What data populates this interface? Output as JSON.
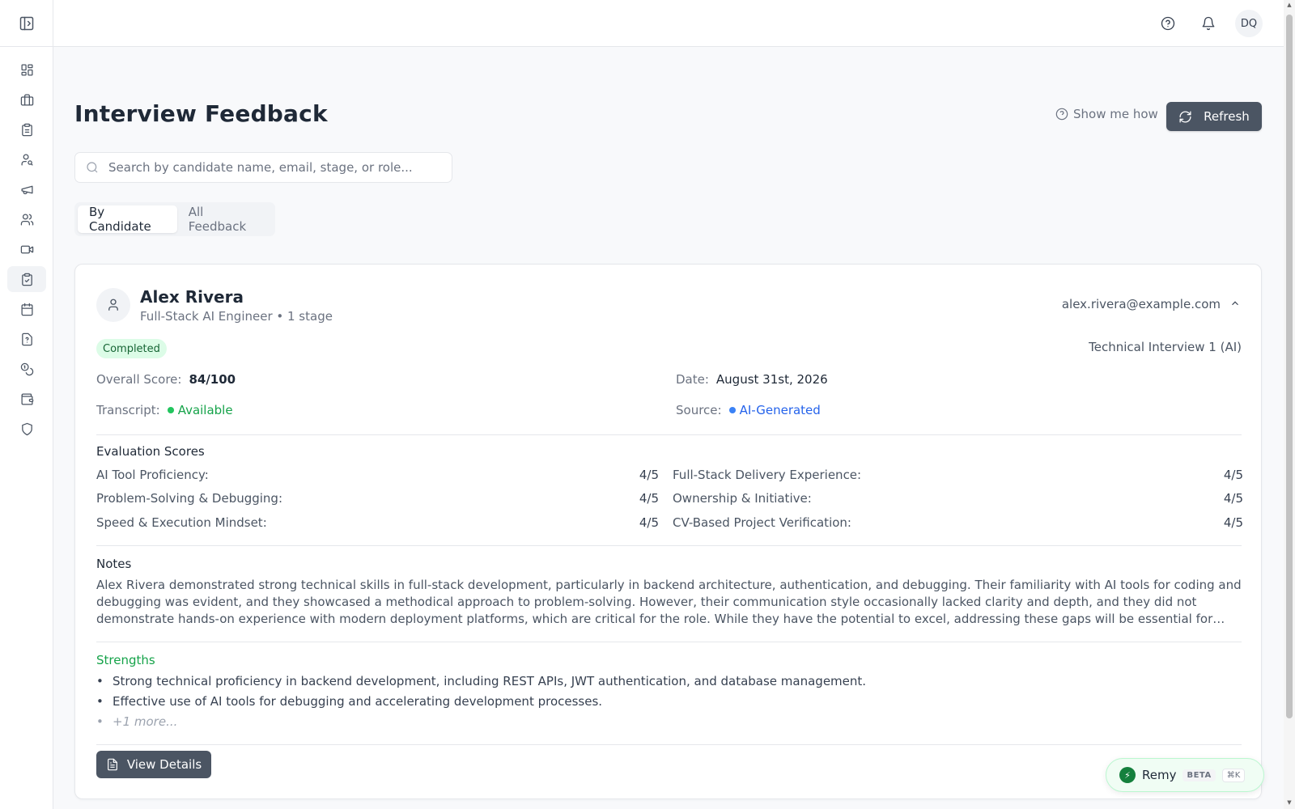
{
  "sidebar": {
    "items": [
      {
        "icon": "grid-icon",
        "active": false
      },
      {
        "icon": "briefcase-icon",
        "active": false
      },
      {
        "icon": "clipboard-icon",
        "active": false
      },
      {
        "icon": "user-search-icon",
        "active": false
      },
      {
        "icon": "megaphone-icon",
        "active": false
      },
      {
        "icon": "users-icon",
        "active": false
      },
      {
        "icon": "video-icon",
        "active": false
      },
      {
        "icon": "clipboard-check-icon",
        "active": true
      },
      {
        "icon": "calendar-icon",
        "active": false
      },
      {
        "icon": "file-question-icon",
        "active": false
      },
      {
        "icon": "coins-icon",
        "active": false
      },
      {
        "icon": "wallet-icon",
        "active": false
      },
      {
        "icon": "shield-icon",
        "active": false
      }
    ]
  },
  "topbar": {
    "user_initials": "DQ"
  },
  "header": {
    "title": "Interview Feedback",
    "show_me_how": "Show me how",
    "refresh": "Refresh"
  },
  "search": {
    "placeholder": "Search by candidate name, email, stage, or role...",
    "value": ""
  },
  "tabs": [
    {
      "label": "By Candidate",
      "active": true
    },
    {
      "label": "All Feedback",
      "active": false
    }
  ],
  "candidate": {
    "name": "Alex Rivera",
    "subtitle": "Full-Stack AI Engineer • 1 stage",
    "email": "alex.rivera@example.com",
    "status": "Completed",
    "stage": "Technical Interview 1 (AI)",
    "overall_score_label": "Overall Score:",
    "overall_score": "84/100",
    "date_label": "Date:",
    "date": "August 31st, 2026",
    "transcript_label": "Transcript:",
    "transcript": "Available",
    "source_label": "Source:",
    "source": "AI-Generated",
    "evaluation_title": "Evaluation Scores",
    "scores": [
      {
        "label": "AI Tool Proficiency:",
        "value": "4/5"
      },
      {
        "label": "Full-Stack Delivery Experience:",
        "value": "4/5"
      },
      {
        "label": "Problem-Solving & Debugging:",
        "value": "4/5"
      },
      {
        "label": "Ownership & Initiative:",
        "value": "4/5"
      },
      {
        "label": "Speed & Execution Mindset:",
        "value": "4/5"
      },
      {
        "label": "CV-Based Project Verification:",
        "value": "4/5"
      }
    ],
    "notes_title": "Notes",
    "notes": "Alex Rivera demonstrated strong technical skills in full-stack development, particularly in backend architecture, authentication, and debugging. Their familiarity with AI tools for coding and debugging was evident, and they showcased a methodical approach to problem-solving. However, their communication style occasionally lacked clarity and depth, and they did not demonstrate hands-on experience with modern deployment platforms, which are critical for the role. While they have the potential to excel, addressing these gaps will be essential for succes...",
    "strengths_title": "Strengths",
    "strengths": [
      "Strong technical proficiency in backend development, including REST APIs, JWT authentication, and database management.",
      "Effective use of AI tools for debugging and accelerating development processes."
    ],
    "strengths_more": "+1 more...",
    "view_details": "View Details"
  },
  "assistant": {
    "name": "Remy",
    "badge": "BETA",
    "shortcut": "⌘K"
  },
  "colors": {
    "primary_button": "#4b5563",
    "success": "#16a34a",
    "link": "#2563eb"
  }
}
